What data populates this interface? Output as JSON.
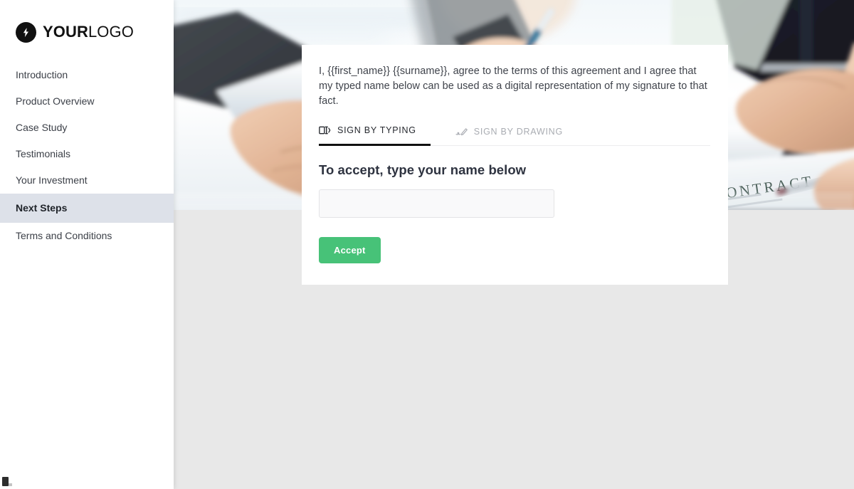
{
  "brand": {
    "logo_bold": "YOUR",
    "logo_light": "LOGO",
    "logo_icon": "lightning-bolt-icon"
  },
  "sidebar": {
    "items": [
      {
        "label": "Introduction",
        "active": false
      },
      {
        "label": "Product Overview",
        "active": false
      },
      {
        "label": "Case Study",
        "active": false
      },
      {
        "label": "Testimonials",
        "active": false
      },
      {
        "label": "Your Investment",
        "active": false
      },
      {
        "label": "Next Steps",
        "active": true
      },
      {
        "label": "Terms and Conditions",
        "active": false
      }
    ]
  },
  "hero": {
    "alt": "Business handshake over a signed contract on a desk",
    "document_word": "CONTRACT"
  },
  "signature_card": {
    "consent_text": "I, {{first_name}} {{surname}}, agree to the terms of this agreement and I agree that my typed name below can be used as a digital representation of my signature to that fact.",
    "tabs": [
      {
        "label": "SIGN BY TYPING",
        "icon": "keyboard-text-box-icon",
        "active": true
      },
      {
        "label": "SIGN BY DRAWING",
        "icon": "pen-signature-icon",
        "active": false
      }
    ],
    "form_title": "To accept, type your name below",
    "name_input_value": "",
    "name_input_placeholder": "",
    "accept_label": "Accept"
  },
  "colors": {
    "accent_green": "#47c278",
    "page_background": "#e8e8e8",
    "sidebar_active": "#dde1e9",
    "text_dark": "#2e3340"
  }
}
